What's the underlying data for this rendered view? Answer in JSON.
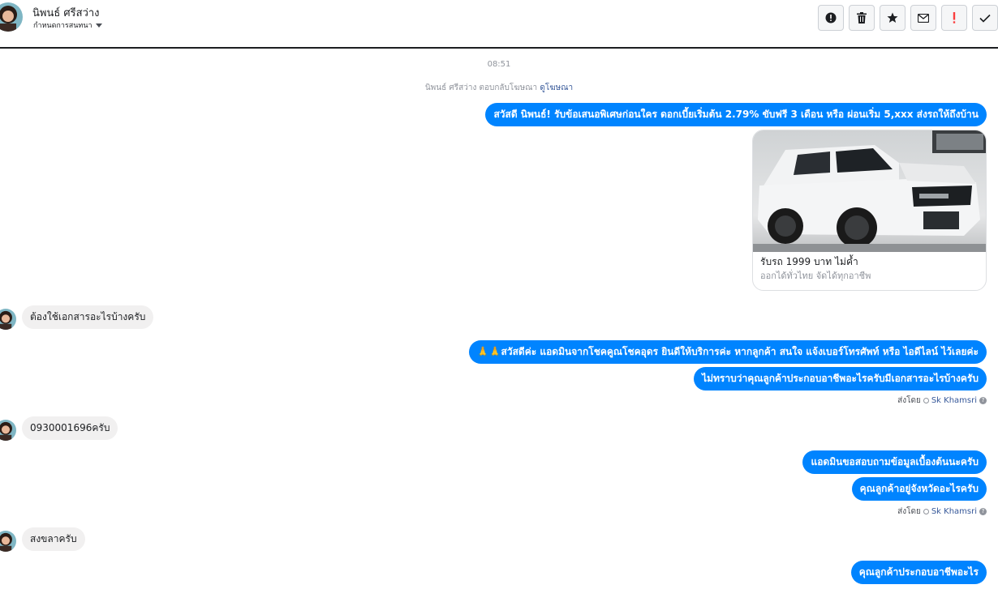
{
  "header": {
    "contact_name": "นิพนธ์ ศรีสว่าง",
    "assign_label": "กำหนดการสนทนา"
  },
  "toolbar": {
    "buttons": [
      {
        "icon": "alert-circle-icon"
      },
      {
        "icon": "trash-icon"
      },
      {
        "icon": "star-icon"
      },
      {
        "icon": "envelope-icon"
      },
      {
        "icon": "exclamation-icon",
        "color": "#fa3e3e"
      },
      {
        "icon": "checkmark-icon"
      }
    ]
  },
  "conversation": {
    "time": "08:51",
    "reply_note": "นิพนธ์ ศรีสว่าง ตอบกลับโฆษณา",
    "reply_link": "ดูโฆษณา",
    "messages": [
      {
        "from": "page",
        "text": "สวัสดี นิพนธ์! รับข้อเสนอพิเศษก่อนใคร ดอกเบี้ยเริ่มต้น 2.79%  ขับฟรี 3 เดือน หรือ ผ่อนเริ่ม 5,xxx ส่งรถให้ถึงบ้าน"
      },
      {
        "from": "user",
        "text": "ต้องใช้เอกสารอะไรบ้างครับ"
      },
      {
        "from": "page",
        "text": "🙏🙏สวัสดีค่ะ แอดมินจากโชคคูณโชคอุดร ยินดีให้บริการค่ะ หากลูกค้า สนใจ แจ้งเบอร์โทรศัพท์ หรือ ไอดีไลน์ ไว้เลยค่ะ"
      },
      {
        "from": "page",
        "text": "ไม่ทราบว่าคุณลูกค้าประกอบอาชีพอะไรครับมีเอกสารอะไรบ้างครับ"
      },
      {
        "from": "user",
        "text": "0930001696ครับ"
      },
      {
        "from": "page",
        "text": "แอดมินขอสอบถามข้อมูลเบื้องต้นนะครับ"
      },
      {
        "from": "page",
        "text": "คุณลูกค้าอยู่จังหวัดอะไรครับ"
      },
      {
        "from": "user",
        "text": "สงขลาครับ"
      },
      {
        "from": "page",
        "text": "คุณลูกค้าประกอบอาชีพอะไร"
      }
    ],
    "ad_card": {
      "title": "รับรถ 1999 บาท ไม่ค้ำ",
      "subtitle": "ออกได้ทั่วไทย จัดได้ทุกอาชีพ",
      "image": "white-isuzu-pickup-truck"
    },
    "sent_by": {
      "prefix": "ส่งโดย",
      "name": "Sk Khamsri",
      "help": "?"
    }
  },
  "colors": {
    "outgoing_bubble": "#0084ff",
    "incoming_bubble": "#f1f0f0",
    "link": "#365899"
  }
}
